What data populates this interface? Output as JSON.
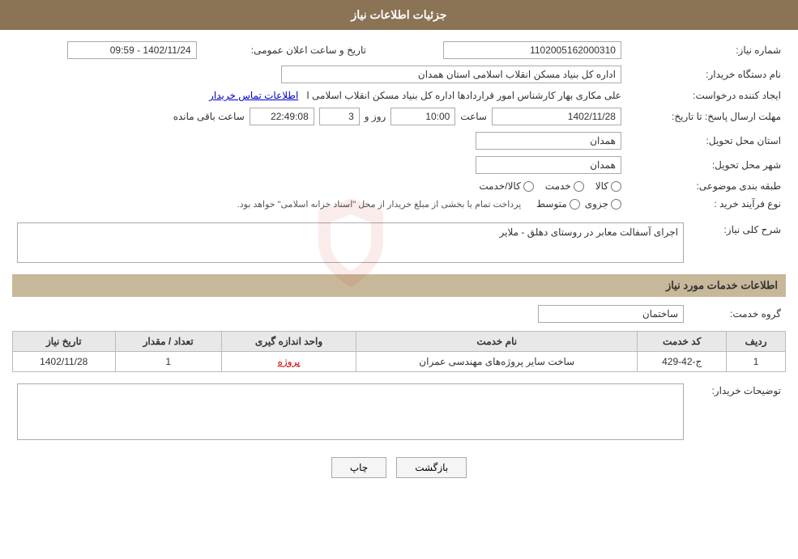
{
  "header": {
    "title": "جزئیات اطلاعات نیاز"
  },
  "fields": {
    "shomareNiaz_label": "شماره نیاز:",
    "shomareNiaz_value": "1102005162000310",
    "namDastgah_label": "نام دستگاه خریدار:",
    "namDastgah_value": "اداره کل بنیاد مسکن انقلاب اسلامی استان همدان",
    "ijadKonande_label": "ایجاد کننده درخواست:",
    "ijadKonande_value": "علی مکاری بهار کارشناس امور قراردادها اداره کل بنیاد مسکن انقلاب اسلامی ا",
    "ettelaat_link": "اطلاعات تماس خریدار",
    "mohlat_label": "مهلت ارسال پاسخ: تا تاریخ:",
    "tarikh_value": "1402/11/28",
    "saat_label": "ساعت",
    "saat_value": "10:00",
    "rooz_label": "روز و",
    "rooz_value": "3",
    "baghimande_label": "ساعت باقی مانده",
    "baghimande_value": "22:49:08",
    "ostan_label": "استان محل تحویل:",
    "ostan_value": "همدان",
    "shahr_label": "شهر محل تحویل:",
    "shahr_value": "همدان",
    "tarifBandi_label": "طبقه بندی موضوعی:",
    "tarifBandi_kala": "کالا",
    "tarifBandi_khedmat": "خدمت",
    "tarifBandi_kalaKhedmat": "کالا/خدمت",
    "nowFarayand_label": "نوع فرآیند خرید :",
    "nowFarayand_jozvi": "جزوی",
    "nowFarayand_mottaset": "متوسط",
    "nowFarayand_note": "پرداخت تمام یا بخشی از مبلغ خریدار از محل \"اسناد خزانه اسلامی\" خواهد بود.",
    "tarikh_elan_label": "تاریخ و ساعت اعلان عمومی:",
    "tarikh_elan_value": "1402/11/24 - 09:59"
  },
  "sharh": {
    "section_title": "شرح کلی نیاز:",
    "value": "اجرای آسفالت معابر در روستای دهلق  -  ملایر"
  },
  "khadamat": {
    "section_title": "اطلاعات خدمات مورد نیاز",
    "goroh_label": "گروه خدمت:",
    "goroh_value": "ساختمان",
    "table": {
      "headers": [
        "ردیف",
        "کد خدمت",
        "نام خدمت",
        "واحد اندازه گیری",
        "تعداد / مقدار",
        "تاریخ نیاز"
      ],
      "rows": [
        {
          "radif": "1",
          "kod": "ج-42-429",
          "name": "ساخت سایر پروژه‌های مهندسی عمران",
          "vahed": "پروژه",
          "tedad": "1",
          "tarikh": "1402/11/28"
        }
      ]
    }
  },
  "tawzihat": {
    "label": "توضیحات خریدار:",
    "value": ""
  },
  "buttons": {
    "chap": "چاپ",
    "bazgasht": "بازگشت"
  }
}
